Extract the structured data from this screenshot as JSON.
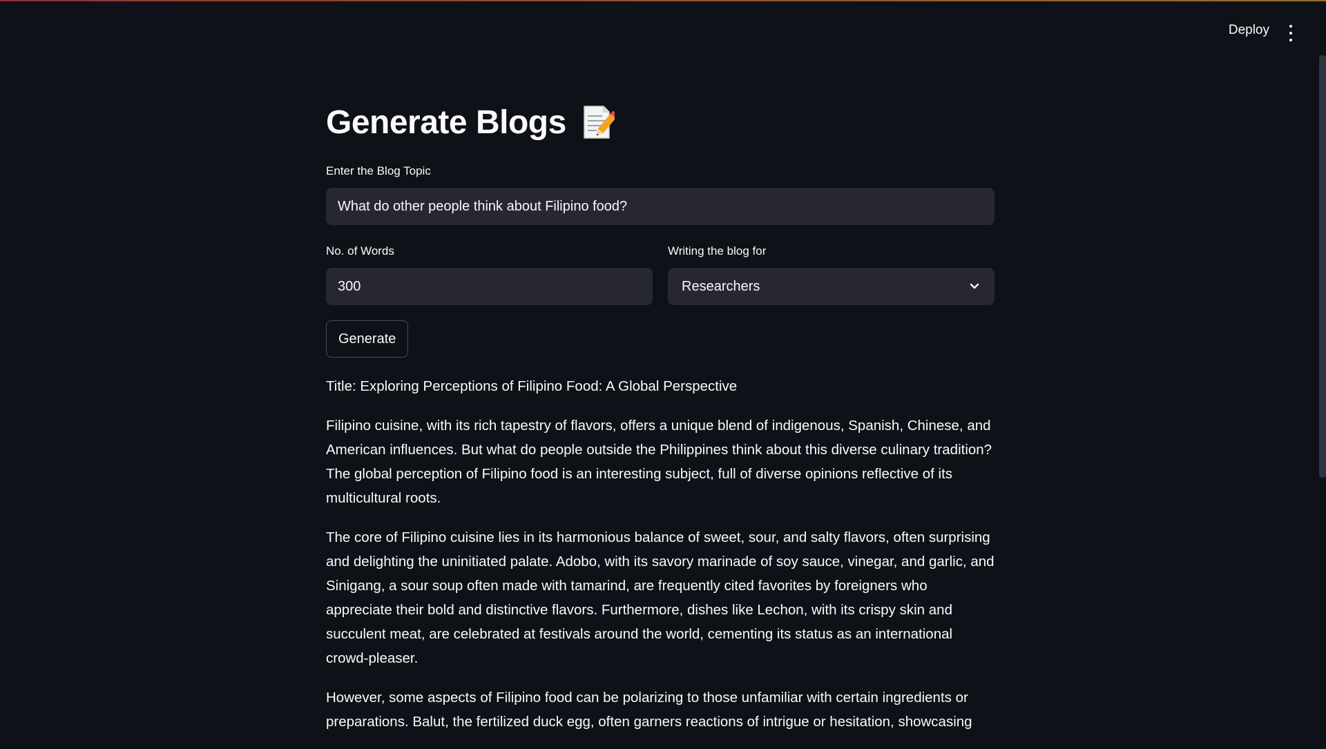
{
  "header": {
    "deploy_label": "Deploy",
    "menu_icon": "kebab-menu-icon"
  },
  "page": {
    "title": "Generate Blogs",
    "title_icon": "memo-icon"
  },
  "form": {
    "topic_label": "Enter the Blog Topic",
    "topic_value": "What do other people think about Filipino food?",
    "words_label": "No. of Words",
    "words_value": "300",
    "audience_label": "Writing the blog for",
    "audience_value": "Researchers",
    "generate_label": "Generate"
  },
  "output": {
    "title_line": "Title: Exploring Perceptions of Filipino Food: A Global Perspective",
    "paragraphs": [
      "Filipino cuisine, with its rich tapestry of flavors, offers a unique blend of indigenous, Spanish, Chinese, and American influences. But what do people outside the Philippines think about this diverse culinary tradition? The global perception of Filipino food is an interesting subject, full of diverse opinions reflective of its multicultural roots.",
      "The core of Filipino cuisine lies in its harmonious balance of sweet, sour, and salty flavors, often surprising and delighting the uninitiated palate. Adobo, with its savory marinade of soy sauce, vinegar, and garlic, and Sinigang, a sour soup often made with tamarind, are frequently cited favorites by foreigners who appreciate their bold and distinctive flavors. Furthermore, dishes like Lechon, with its crispy skin and succulent meat, are celebrated at festivals around the world, cementing its status as an international crowd-pleaser.",
      "However, some aspects of Filipino food can be polarizing to those unfamiliar with certain ingredients or preparations. Balut, the fertilized duck egg, often garners reactions of intrigue or hesitation, showcasing"
    ]
  },
  "colors": {
    "background": "#0e1117",
    "input_bg": "#262730",
    "text": "#fafafa",
    "accent": "#ff4b4b"
  }
}
